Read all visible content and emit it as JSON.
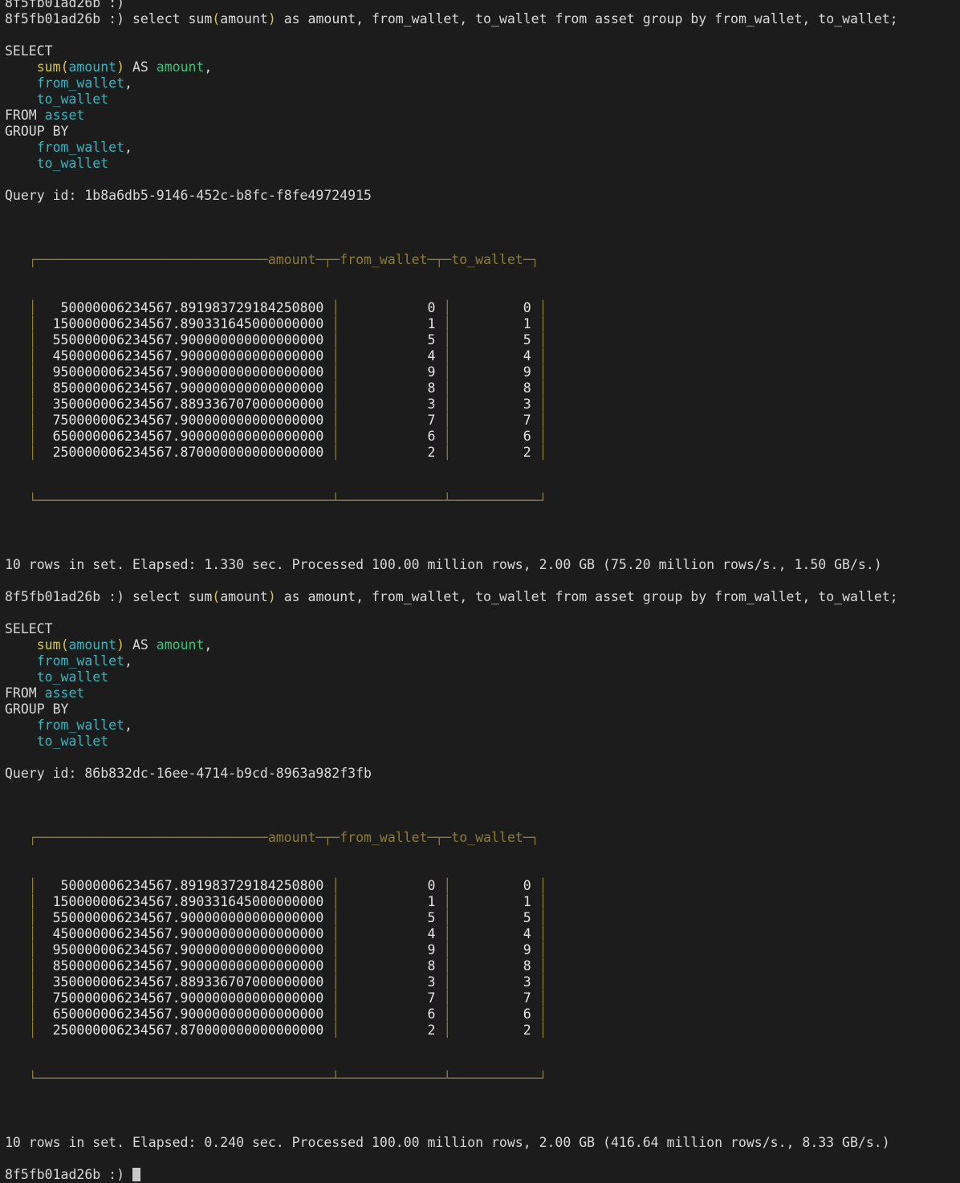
{
  "terminal": {
    "prompt": "8f5fb01ad26b :) ",
    "hostname": "8f5fb01ad26b",
    "prompt_symbol": ":)",
    "background_color": "#1c1c1c",
    "foreground_color": "#d8d8d8",
    "border_color": "#8d7b35"
  },
  "command": {
    "raw": "select sum(amount) as amount, from_wallet, to_wallet from asset group by from_wallet, to_wallet;",
    "pre_paren": "select sum",
    "open_paren": "(",
    "arg": "amount",
    "close_paren": ")",
    "post_paren": " as amount, from_wallet, to_wallet from asset group by from_wallet, to_wallet;"
  },
  "formatted_query": {
    "line1": "SELECT",
    "line2_fn": "sum",
    "line2_open": "(",
    "line2_arg": "amount",
    "line2_close": ")",
    "line2_as": " AS ",
    "line2_alias": "amount",
    "line2_comma": ",",
    "line3_ident": "from_wallet",
    "line3_comma": ",",
    "line4_ident": "to_wallet",
    "line5_kw": "FROM ",
    "line5_table": "asset",
    "line6": "GROUP BY",
    "line7_ident": "from_wallet",
    "line7_comma": ",",
    "line8_ident": "to_wallet",
    "indent": "    "
  },
  "results": [
    {
      "query_id_label": "Query id: ",
      "query_id": "1b8a6db5-9146-452c-b8fc-f8fe49724915",
      "top_border": "   ┌─────────────────────────────amount─┬─from_wallet─┬─to_wallet─┐",
      "bottom_border": "   └─────────────────────────────────────┴─────────────┴───────────┘",
      "columns": [
        "amount",
        "from_wallet",
        "to_wallet"
      ],
      "rows": [
        {
          "amount": "50000006234567.891983729184250800",
          "from_wallet": "0",
          "to_wallet": "0"
        },
        {
          "amount": "150000006234567.890331645000000000",
          "from_wallet": "1",
          "to_wallet": "1"
        },
        {
          "amount": "550000006234567.900000000000000000",
          "from_wallet": "5",
          "to_wallet": "5"
        },
        {
          "amount": "450000006234567.900000000000000000",
          "from_wallet": "4",
          "to_wallet": "4"
        },
        {
          "amount": "950000006234567.900000000000000000",
          "from_wallet": "9",
          "to_wallet": "9"
        },
        {
          "amount": "850000006234567.900000000000000000",
          "from_wallet": "8",
          "to_wallet": "8"
        },
        {
          "amount": "350000006234567.889336707000000000",
          "from_wallet": "3",
          "to_wallet": "3"
        },
        {
          "amount": "750000006234567.900000000000000000",
          "from_wallet": "7",
          "to_wallet": "7"
        },
        {
          "amount": "650000006234567.900000000000000000",
          "from_wallet": "6",
          "to_wallet": "6"
        },
        {
          "amount": "250000006234567.870000000000000000",
          "from_wallet": "2",
          "to_wallet": "2"
        }
      ],
      "status": "10 rows in set. Elapsed: 1.330 sec. Processed 100.00 million rows, 2.00 GB (75.20 million rows/s., 1.50 GB/s.)",
      "row_count": "10",
      "elapsed": "1.330 sec",
      "processed_rows": "100.00 million rows",
      "processed_bytes": "2.00 GB",
      "throughput_rows": "75.20 million rows/s.",
      "throughput_bytes": "1.50 GB/s."
    },
    {
      "query_id_label": "Query id: ",
      "query_id": "86b832dc-16ee-4714-b9cd-8963a982f3fb",
      "top_border": "   ┌─────────────────────────────amount─┬─from_wallet─┬─to_wallet─┐",
      "bottom_border": "   └─────────────────────────────────────┴─────────────┴───────────┘",
      "columns": [
        "amount",
        "from_wallet",
        "to_wallet"
      ],
      "rows": [
        {
          "amount": "50000006234567.891983729184250800",
          "from_wallet": "0",
          "to_wallet": "0"
        },
        {
          "amount": "150000006234567.890331645000000000",
          "from_wallet": "1",
          "to_wallet": "1"
        },
        {
          "amount": "550000006234567.900000000000000000",
          "from_wallet": "5",
          "to_wallet": "5"
        },
        {
          "amount": "450000006234567.900000000000000000",
          "from_wallet": "4",
          "to_wallet": "4"
        },
        {
          "amount": "950000006234567.900000000000000000",
          "from_wallet": "9",
          "to_wallet": "9"
        },
        {
          "amount": "850000006234567.900000000000000000",
          "from_wallet": "8",
          "to_wallet": "8"
        },
        {
          "amount": "350000006234567.889336707000000000",
          "from_wallet": "3",
          "to_wallet": "3"
        },
        {
          "amount": "750000006234567.900000000000000000",
          "from_wallet": "7",
          "to_wallet": "7"
        },
        {
          "amount": "650000006234567.900000000000000000",
          "from_wallet": "6",
          "to_wallet": "6"
        },
        {
          "amount": "250000006234567.870000000000000000",
          "from_wallet": "2",
          "to_wallet": "2"
        }
      ],
      "status": "10 rows in set. Elapsed: 0.240 sec. Processed 100.00 million rows, 2.00 GB (416.64 million rows/s., 8.33 GB/s.)",
      "row_count": "10",
      "elapsed": "0.240 sec",
      "processed_rows": "100.00 million rows",
      "processed_bytes": "2.00 GB",
      "throughput_rows": "416.64 million rows/s.",
      "throughput_bytes": "8.33 GB/s."
    }
  ]
}
